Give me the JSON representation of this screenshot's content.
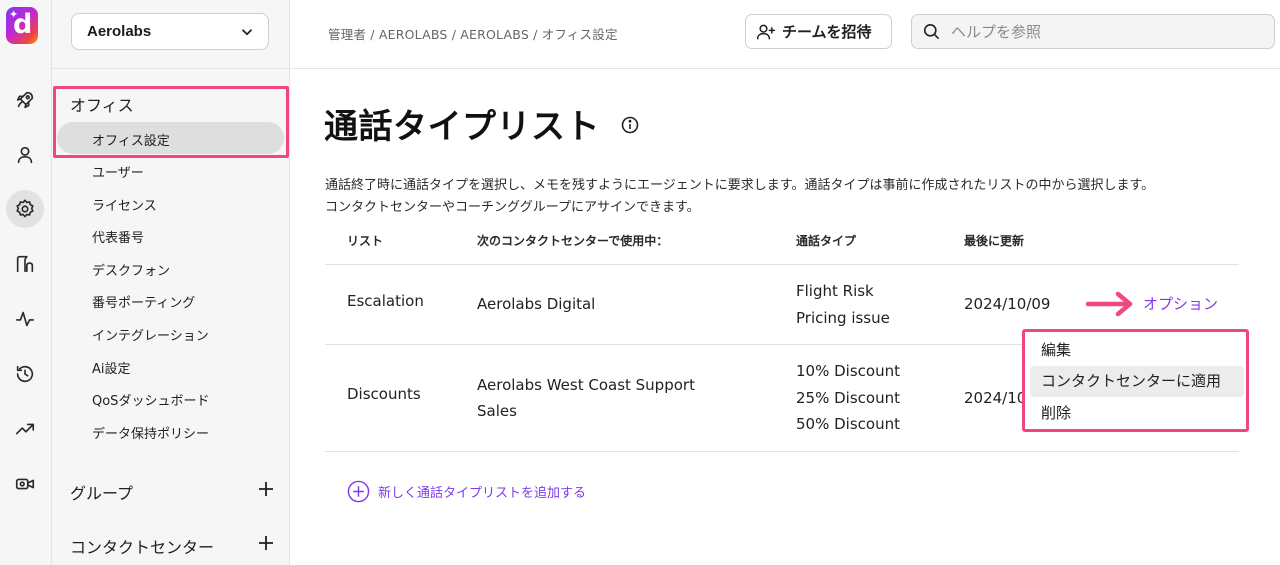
{
  "rail": {
    "logo_letter": "d",
    "items": [
      {
        "icon": "rocket-icon"
      },
      {
        "icon": "person-icon"
      },
      {
        "icon": "gear-icon",
        "active": true
      },
      {
        "icon": "routing-icon"
      },
      {
        "icon": "activity-icon"
      },
      {
        "icon": "history-icon"
      },
      {
        "icon": "trending-icon"
      },
      {
        "icon": "video-camera-icon"
      }
    ]
  },
  "nav": {
    "workspace": "Aerolabs",
    "office_section": "オフィス",
    "office_items": [
      "オフィス設定",
      "ユーザー",
      "ライセンス",
      "代表番号",
      "デスクフォン",
      "番号ポーティング",
      "インテグレーション",
      "Ai設定",
      "QoSダッシュボード",
      "データ保持ポリシー"
    ],
    "groups_section": "グループ",
    "contact_center_section": "コンタクトセンター"
  },
  "header": {
    "breadcrumb": "管理者 / AEROLABS / AEROLABS / オフィス設定",
    "invite_label": "チームを招待",
    "search_placeholder": "ヘルプを参照"
  },
  "main": {
    "title": "通話タイプリスト",
    "description_line1": "通話終了時に通話タイプを選択し、メモを残すようにエージェントに要求します。通話タイプは事前に作成されたリストの中から選択します。",
    "description_line2": "コンタクトセンターやコーチンググループにアサインできます。",
    "columns": [
      "リスト",
      "次のコンタクトセンターで使用中：",
      "通話タイプ",
      "最後に更新"
    ],
    "rows": [
      {
        "list": "Escalation",
        "used_in": [
          "Aerolabs Digital"
        ],
        "call_types": [
          "Flight Risk",
          "Pricing issue"
        ],
        "updated": "2024/10/09"
      },
      {
        "list": "Discounts",
        "used_in": [
          "Aerolabs West Coast Support",
          "Sales"
        ],
        "call_types": [
          "10% Discount",
          "25% Discount",
          "50% Discount"
        ],
        "updated": "2024/10"
      }
    ],
    "options_label": "オプション",
    "menu_items": [
      "編集",
      "コンタクトセンターに適用",
      "削除"
    ],
    "add_label": "新しく通話タイプリストを追加する"
  },
  "colors": {
    "accent": "#7c3aed",
    "highlight": "#f0487d"
  }
}
